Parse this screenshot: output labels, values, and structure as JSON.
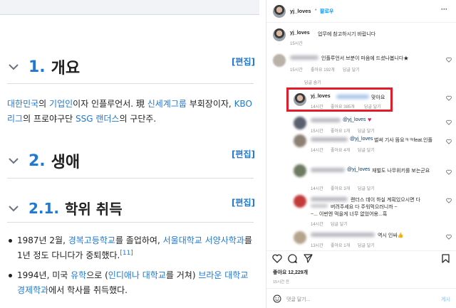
{
  "wiki": {
    "sections": [
      {
        "num": "1.",
        "title": "개요",
        "edit": "[편집]"
      },
      {
        "num": "2.",
        "title": "생애",
        "edit": "[편집]"
      },
      {
        "num": "2.1.",
        "title": "학위 취득",
        "edit": "[편집]"
      }
    ],
    "overview": {
      "a": "대한민국",
      "b": "의 ",
      "c": "기업인",
      "d": "이자 인플루언서. 現 ",
      "e": "신세계그룹",
      "f": " 부회장이자, ",
      "g": "KBO리그",
      "h": "의 프로야구단 ",
      "i": "SSG 랜더스",
      "j": "의 구단주."
    },
    "bullet1": {
      "a": "1987년 2월, ",
      "b": "경복고등학교",
      "c": "를 졸업하여, ",
      "d": "서울대학교 서양사학과",
      "e": "를 1년 정도 다니다가 중퇴했다.",
      "f": "[11]"
    },
    "bullet2": {
      "a": "1994년, 미국 ",
      "b": "유학",
      "c": "으로 (",
      "d": "인디애나 대학교",
      "e": "를 거쳐) ",
      "f": "브라운 대학교 경제학과",
      "g": "에서 학사를 취득했다."
    }
  },
  "instagram": {
    "header": {
      "username": "yj_loves",
      "dot": "•",
      "follow": "팔로우",
      "more": "···"
    },
    "caption": {
      "username": "yj_loves",
      "text": "업무에 참고하시기 바랍니다",
      "time": "15시간"
    },
    "comments": [
      {
        "text": "인플루언서 브분이 마음에 드셨나봅니다★",
        "time": "15시간",
        "likes": "좋아요 192개",
        "reply": "답글 달기",
        "view_replies": "답글 숨기"
      },
      {
        "username": "yj_loves",
        "text": "맞아요",
        "time": "14시간",
        "likes": "좋아요 385개",
        "reply": "답글 달기"
      },
      {
        "mention": "@yj_loves",
        "time": "15시간",
        "likes": "좋아요 1개",
        "reply": "답글 달기"
      },
      {
        "mention": "@yj_loves",
        "text": "벌써 기사 뜸요ㅋㅋfeat.인플",
        "time": "14시간",
        "likes": "좋아요 4개",
        "reply": "답글 달기"
      },
      {
        "mention": "@yj_loves",
        "text": "재벌도 나무위키를 보는군요",
        "time": "14시간",
        "likes": "좋아요 3개",
        "reply": "답글 달기"
      },
      {
        "text1": "랜더스 데이 하실 계획있으시면 다",
        "text2": "버려주세요 다 주워먹으러니까 ~",
        "text3": "~... 이번엔 먹을게 너무 없었어용...흑",
        "time": "14시간",
        "reply": "답글 달기"
      },
      {
        "text": "역시 인싸👍",
        "time": "13시간",
        "likes": "좋아요 1개",
        "reply": "답글 달기"
      }
    ],
    "likes": "좋아요 12,229개",
    "post_time": "15시간 전",
    "comment_placeholder": "댓글 달기...",
    "post_button": "게시"
  }
}
